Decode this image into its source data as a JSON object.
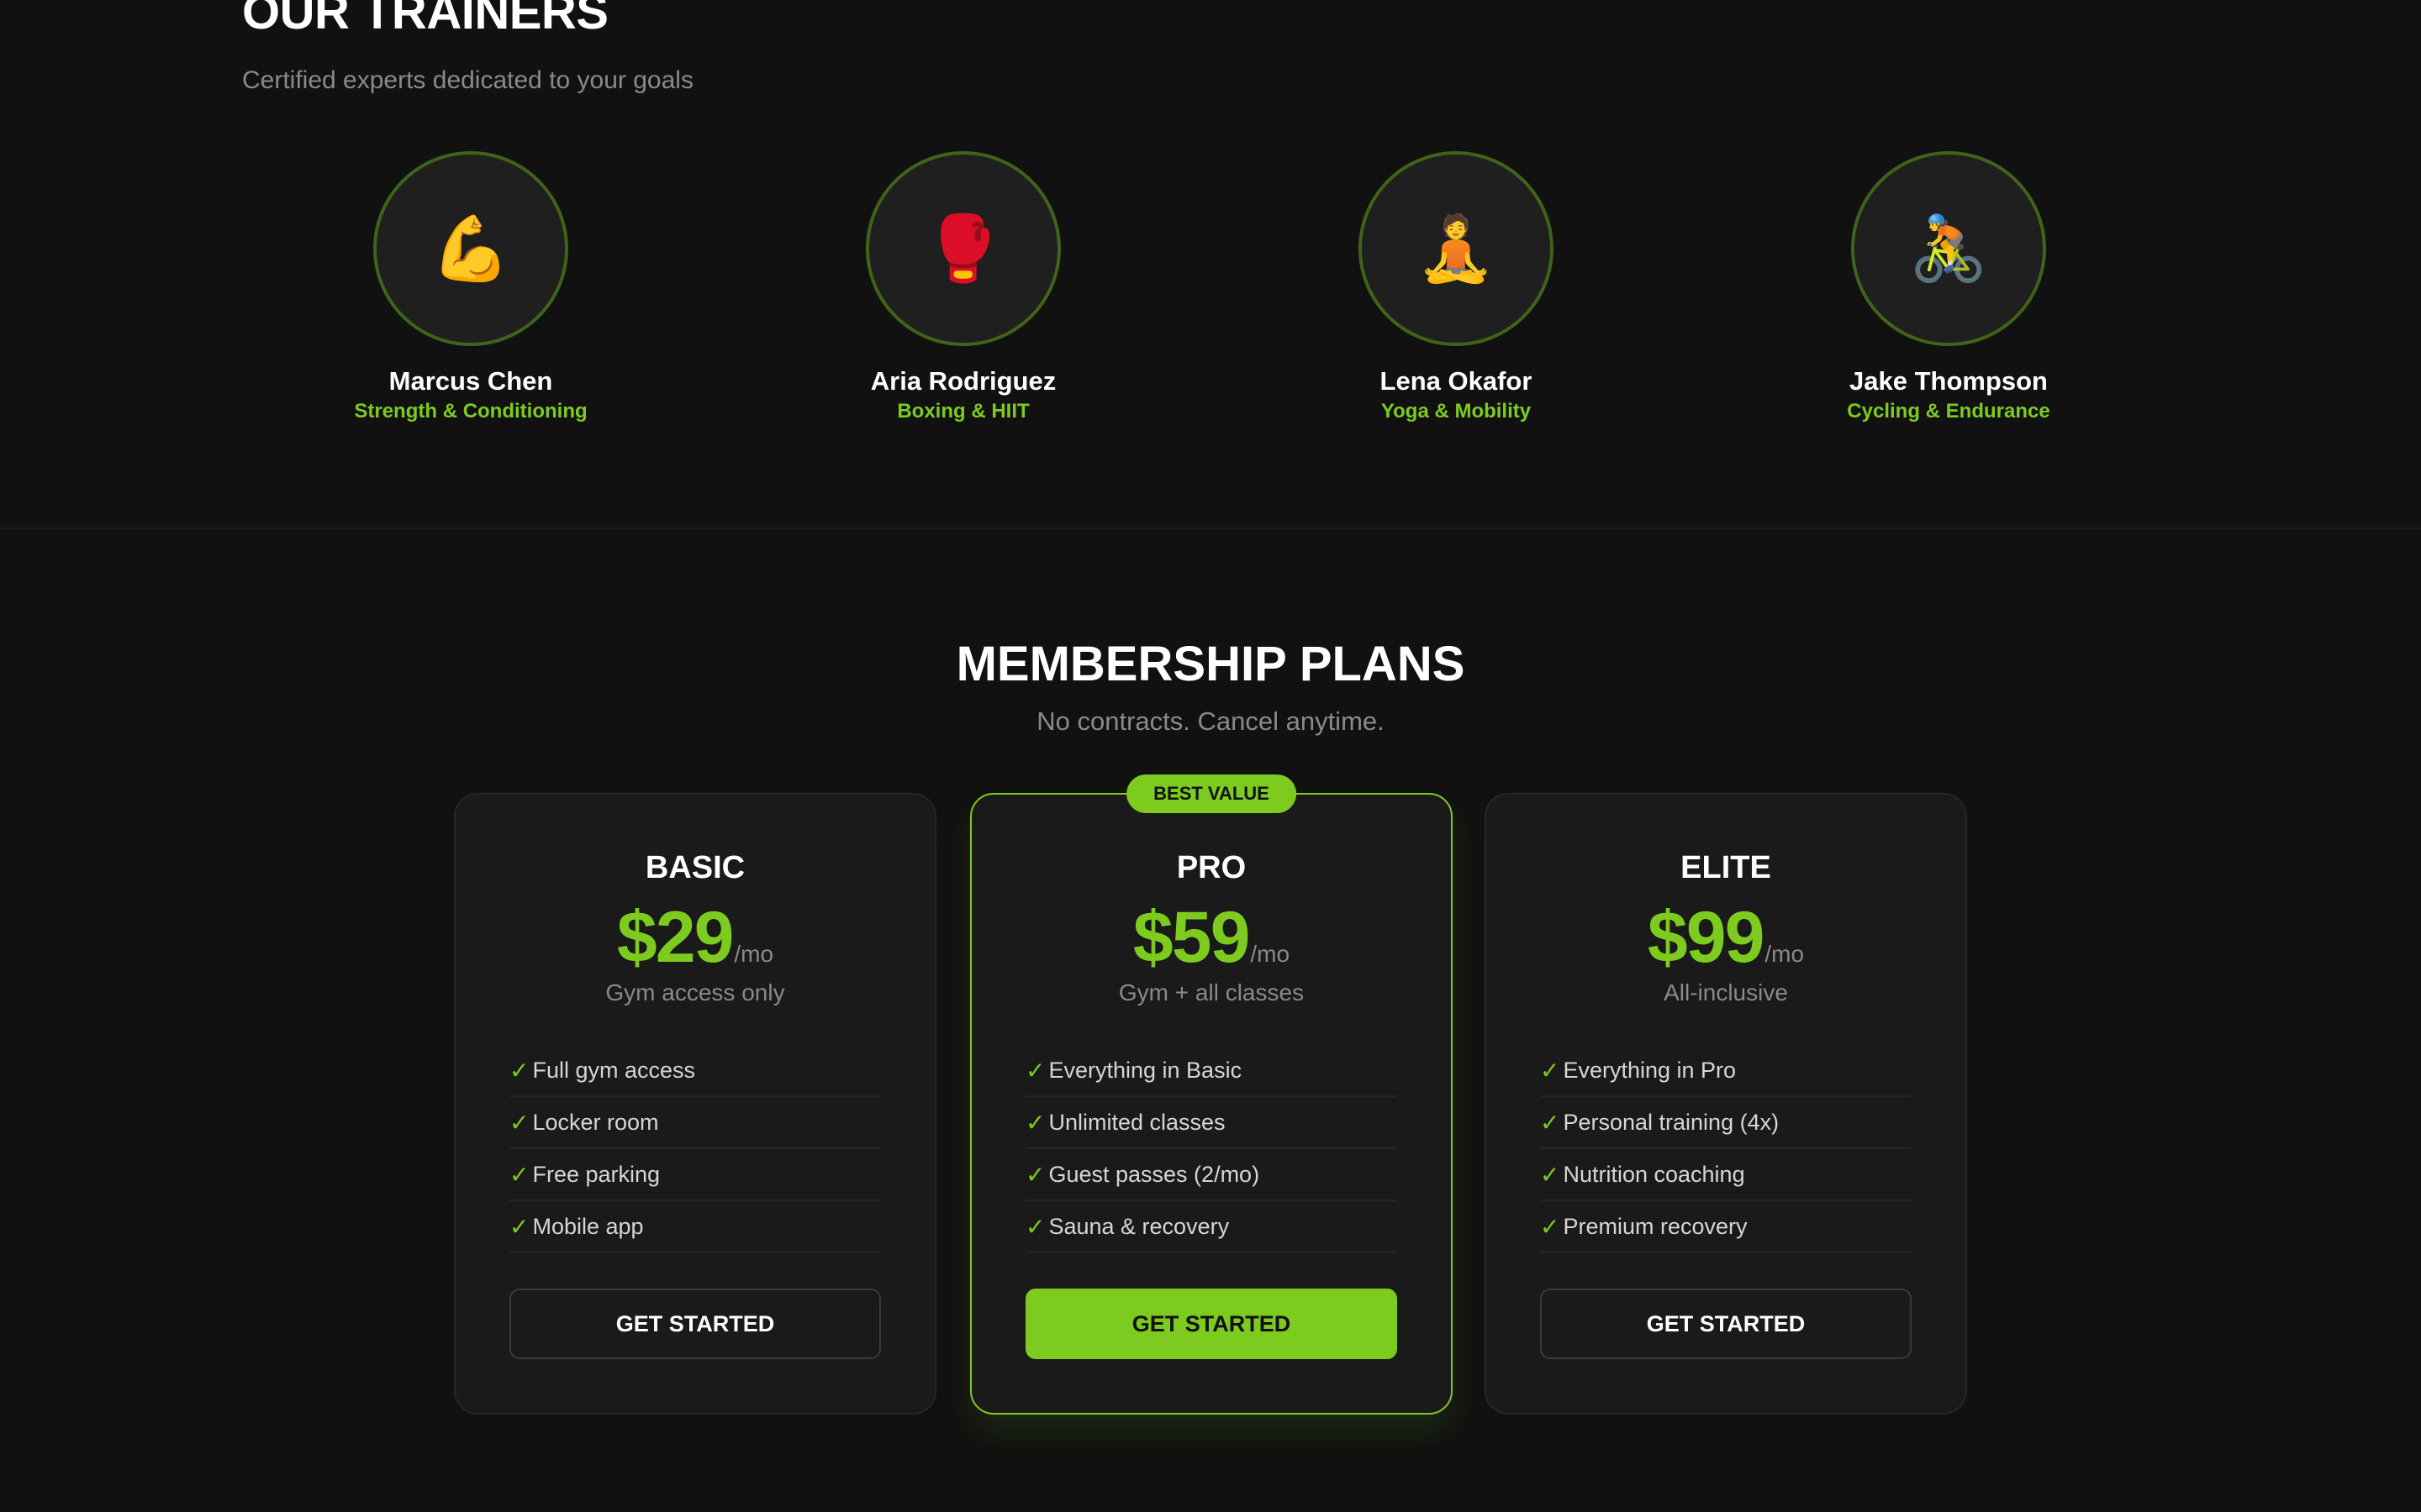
{
  "trainers_section": {
    "title": "OUR TRAINERS",
    "subtitle": "Certified experts dedicated to your goals",
    "trainers": [
      {
        "name": "Marcus Chen",
        "specialty": "Strength & Conditioning",
        "icon": "flexed-biceps-icon",
        "emoji": "💪"
      },
      {
        "name": "Aria Rodriguez",
        "specialty": "Boxing & HIIT",
        "icon": "boxing-glove-icon",
        "emoji": "🥊"
      },
      {
        "name": "Lena Okafor",
        "specialty": "Yoga & Mobility",
        "icon": "meditation-icon",
        "emoji": "🧘"
      },
      {
        "name": "Jake Thompson",
        "specialty": "Cycling & Endurance",
        "icon": "cyclist-icon",
        "emoji": "🚴"
      }
    ]
  },
  "membership_section": {
    "title": "MEMBERSHIP PLANS",
    "subtitle": "No contracts. Cancel anytime.",
    "plans": [
      {
        "name": "BASIC",
        "price": "$29",
        "period": "/mo",
        "description": "Gym access only",
        "features": [
          "Full gym access",
          "Locker room",
          "Free parking",
          "Mobile app"
        ],
        "cta": "GET STARTED"
      },
      {
        "name": "PRO",
        "badge": "BEST VALUE",
        "price": "$59",
        "period": "/mo",
        "description": "Gym + all classes",
        "features": [
          "Everything in Basic",
          "Unlimited classes",
          "Guest passes (2/mo)",
          "Sauna & recovery"
        ],
        "cta": "GET STARTED"
      },
      {
        "name": "ELITE",
        "price": "$99",
        "period": "/mo",
        "description": "All-inclusive",
        "features": [
          "Everything in Pro",
          "Personal training (4x)",
          "Nutrition coaching",
          "Premium recovery"
        ],
        "cta": "GET STARTED"
      }
    ]
  },
  "theme": {
    "background": "#111111",
    "card_background": "#1a1a1a",
    "accent": "#7ccb1e",
    "muted_text": "#8a8a8a"
  },
  "check_glyph": "✓"
}
